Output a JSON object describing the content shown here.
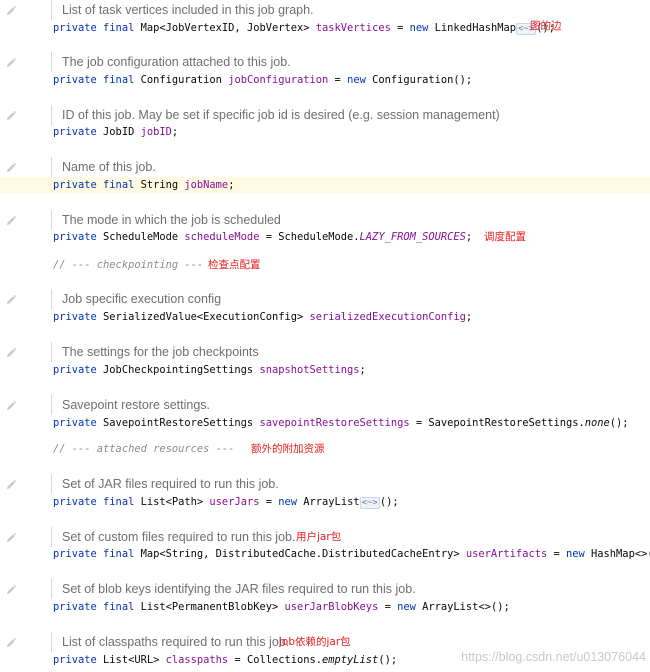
{
  "blocks": [
    {
      "doc": "List of task vertices included in this job graph.",
      "code": [
        [
          "kw",
          "private final "
        ],
        [
          "t",
          "Map<JobVertexID, JobVertex> "
        ],
        [
          "field",
          "taskVertices"
        ],
        [
          "t",
          " = "
        ],
        [
          "kw",
          "new "
        ],
        [
          "t",
          "LinkedHashMap"
        ],
        [
          "fold",
          "<~>"
        ],
        [
          "t",
          "();"
        ]
      ],
      "note": "图的边"
    },
    {
      "doc": "The job configuration attached to this job.",
      "code": [
        [
          "kw",
          "private final "
        ],
        [
          "t",
          "Configuration "
        ],
        [
          "field",
          "jobConfiguration"
        ],
        [
          "t",
          " = "
        ],
        [
          "kw",
          "new "
        ],
        [
          "t",
          "Configuration();"
        ]
      ]
    },
    {
      "doc": "ID of this job. May be set if specific job id is desired (e.g. session management)",
      "code": [
        [
          "kw",
          "private "
        ],
        [
          "t",
          "JobID "
        ],
        [
          "field",
          "jobID"
        ],
        [
          "t",
          ";"
        ]
      ]
    },
    {
      "doc": "Name of this job.",
      "code": [
        [
          "kw",
          "private final "
        ],
        [
          "t",
          "String "
        ],
        [
          "field",
          "jobName"
        ],
        [
          "t",
          ";"
        ]
      ],
      "highlight": true
    },
    {
      "doc": "The mode in which the job is scheduled",
      "code": [
        [
          "kw",
          "private "
        ],
        [
          "t",
          "ScheduleMode "
        ],
        [
          "field",
          "scheduleMode"
        ],
        [
          "t",
          " = ScheduleMode."
        ],
        [
          "static",
          "LAZY_FROM_SOURCES"
        ],
        [
          "t",
          ";"
        ]
      ],
      "note": "调度配置"
    },
    {
      "comment": "// --- checkpointing ---",
      "note": "检查点配置"
    },
    {
      "doc": "Job specific execution config",
      "code": [
        [
          "kw",
          "private "
        ],
        [
          "t",
          "SerializedValue<ExecutionConfig> "
        ],
        [
          "field",
          "serializedExecutionConfig"
        ],
        [
          "t",
          ";"
        ]
      ]
    },
    {
      "doc": "The settings for the job checkpoints",
      "code": [
        [
          "kw",
          "private "
        ],
        [
          "t",
          "JobCheckpointingSettings "
        ],
        [
          "field",
          "snapshotSettings"
        ],
        [
          "t",
          ";"
        ]
      ]
    },
    {
      "doc": "Savepoint restore settings.",
      "code": [
        [
          "kw",
          "private "
        ],
        [
          "t",
          "SavepointRestoreSettings "
        ],
        [
          "field",
          "savepointRestoreSettings"
        ],
        [
          "t",
          " = SavepointRestoreSettings."
        ],
        [
          "static-m",
          "none"
        ],
        [
          "t",
          "();"
        ]
      ]
    },
    {
      "comment": "// --- attached resources ---",
      "note": "额外的附加资源"
    },
    {
      "doc": "Set of JAR files required to run this job.",
      "code": [
        [
          "kw",
          "private final "
        ],
        [
          "t",
          "List<Path> "
        ],
        [
          "field",
          "userJars"
        ],
        [
          "t",
          " = "
        ],
        [
          "kw",
          "new "
        ],
        [
          "t",
          "ArrayList"
        ],
        [
          "fold",
          "<~>"
        ],
        [
          "t",
          "();"
        ]
      ]
    },
    {
      "doc": "Set of custom files required to run this job.",
      "code": [
        [
          "kw",
          "private final "
        ],
        [
          "t",
          "Map<String, DistributedCache.DistributedCacheEntry> "
        ],
        [
          "field",
          "userArtifacts"
        ],
        [
          "t",
          " = "
        ],
        [
          "kw",
          "new "
        ],
        [
          "t",
          "HashMap<>();"
        ]
      ],
      "note": "用户jar包"
    },
    {
      "doc": "Set of blob keys identifying the JAR files required to run this job.",
      "code": [
        [
          "kw",
          "private final "
        ],
        [
          "t",
          "List<PermanentBlobKey> "
        ],
        [
          "field",
          "userJarBlobKeys"
        ],
        [
          "t",
          " = "
        ],
        [
          "kw",
          "new "
        ],
        [
          "t",
          "ArrayList<>();"
        ]
      ]
    },
    {
      "doc": "List of classpaths required to run this job.",
      "code": [
        [
          "kw",
          "private "
        ],
        [
          "t",
          "List<URL> "
        ],
        [
          "field",
          "classpaths"
        ],
        [
          "t",
          " = Collections."
        ],
        [
          "static-m",
          "emptyList"
        ],
        [
          "t",
          "();"
        ]
      ],
      "note": "job依赖的jar包"
    }
  ],
  "watermark": "https://blog.csdn.net/u013076044",
  "colors": {
    "keyword": "#0033b3",
    "field": "#871094",
    "doc": "#6f6f6f",
    "note": "#e41e1e",
    "highlight": "#fffae3"
  },
  "icons": {
    "gutter": "pencil-icon"
  }
}
